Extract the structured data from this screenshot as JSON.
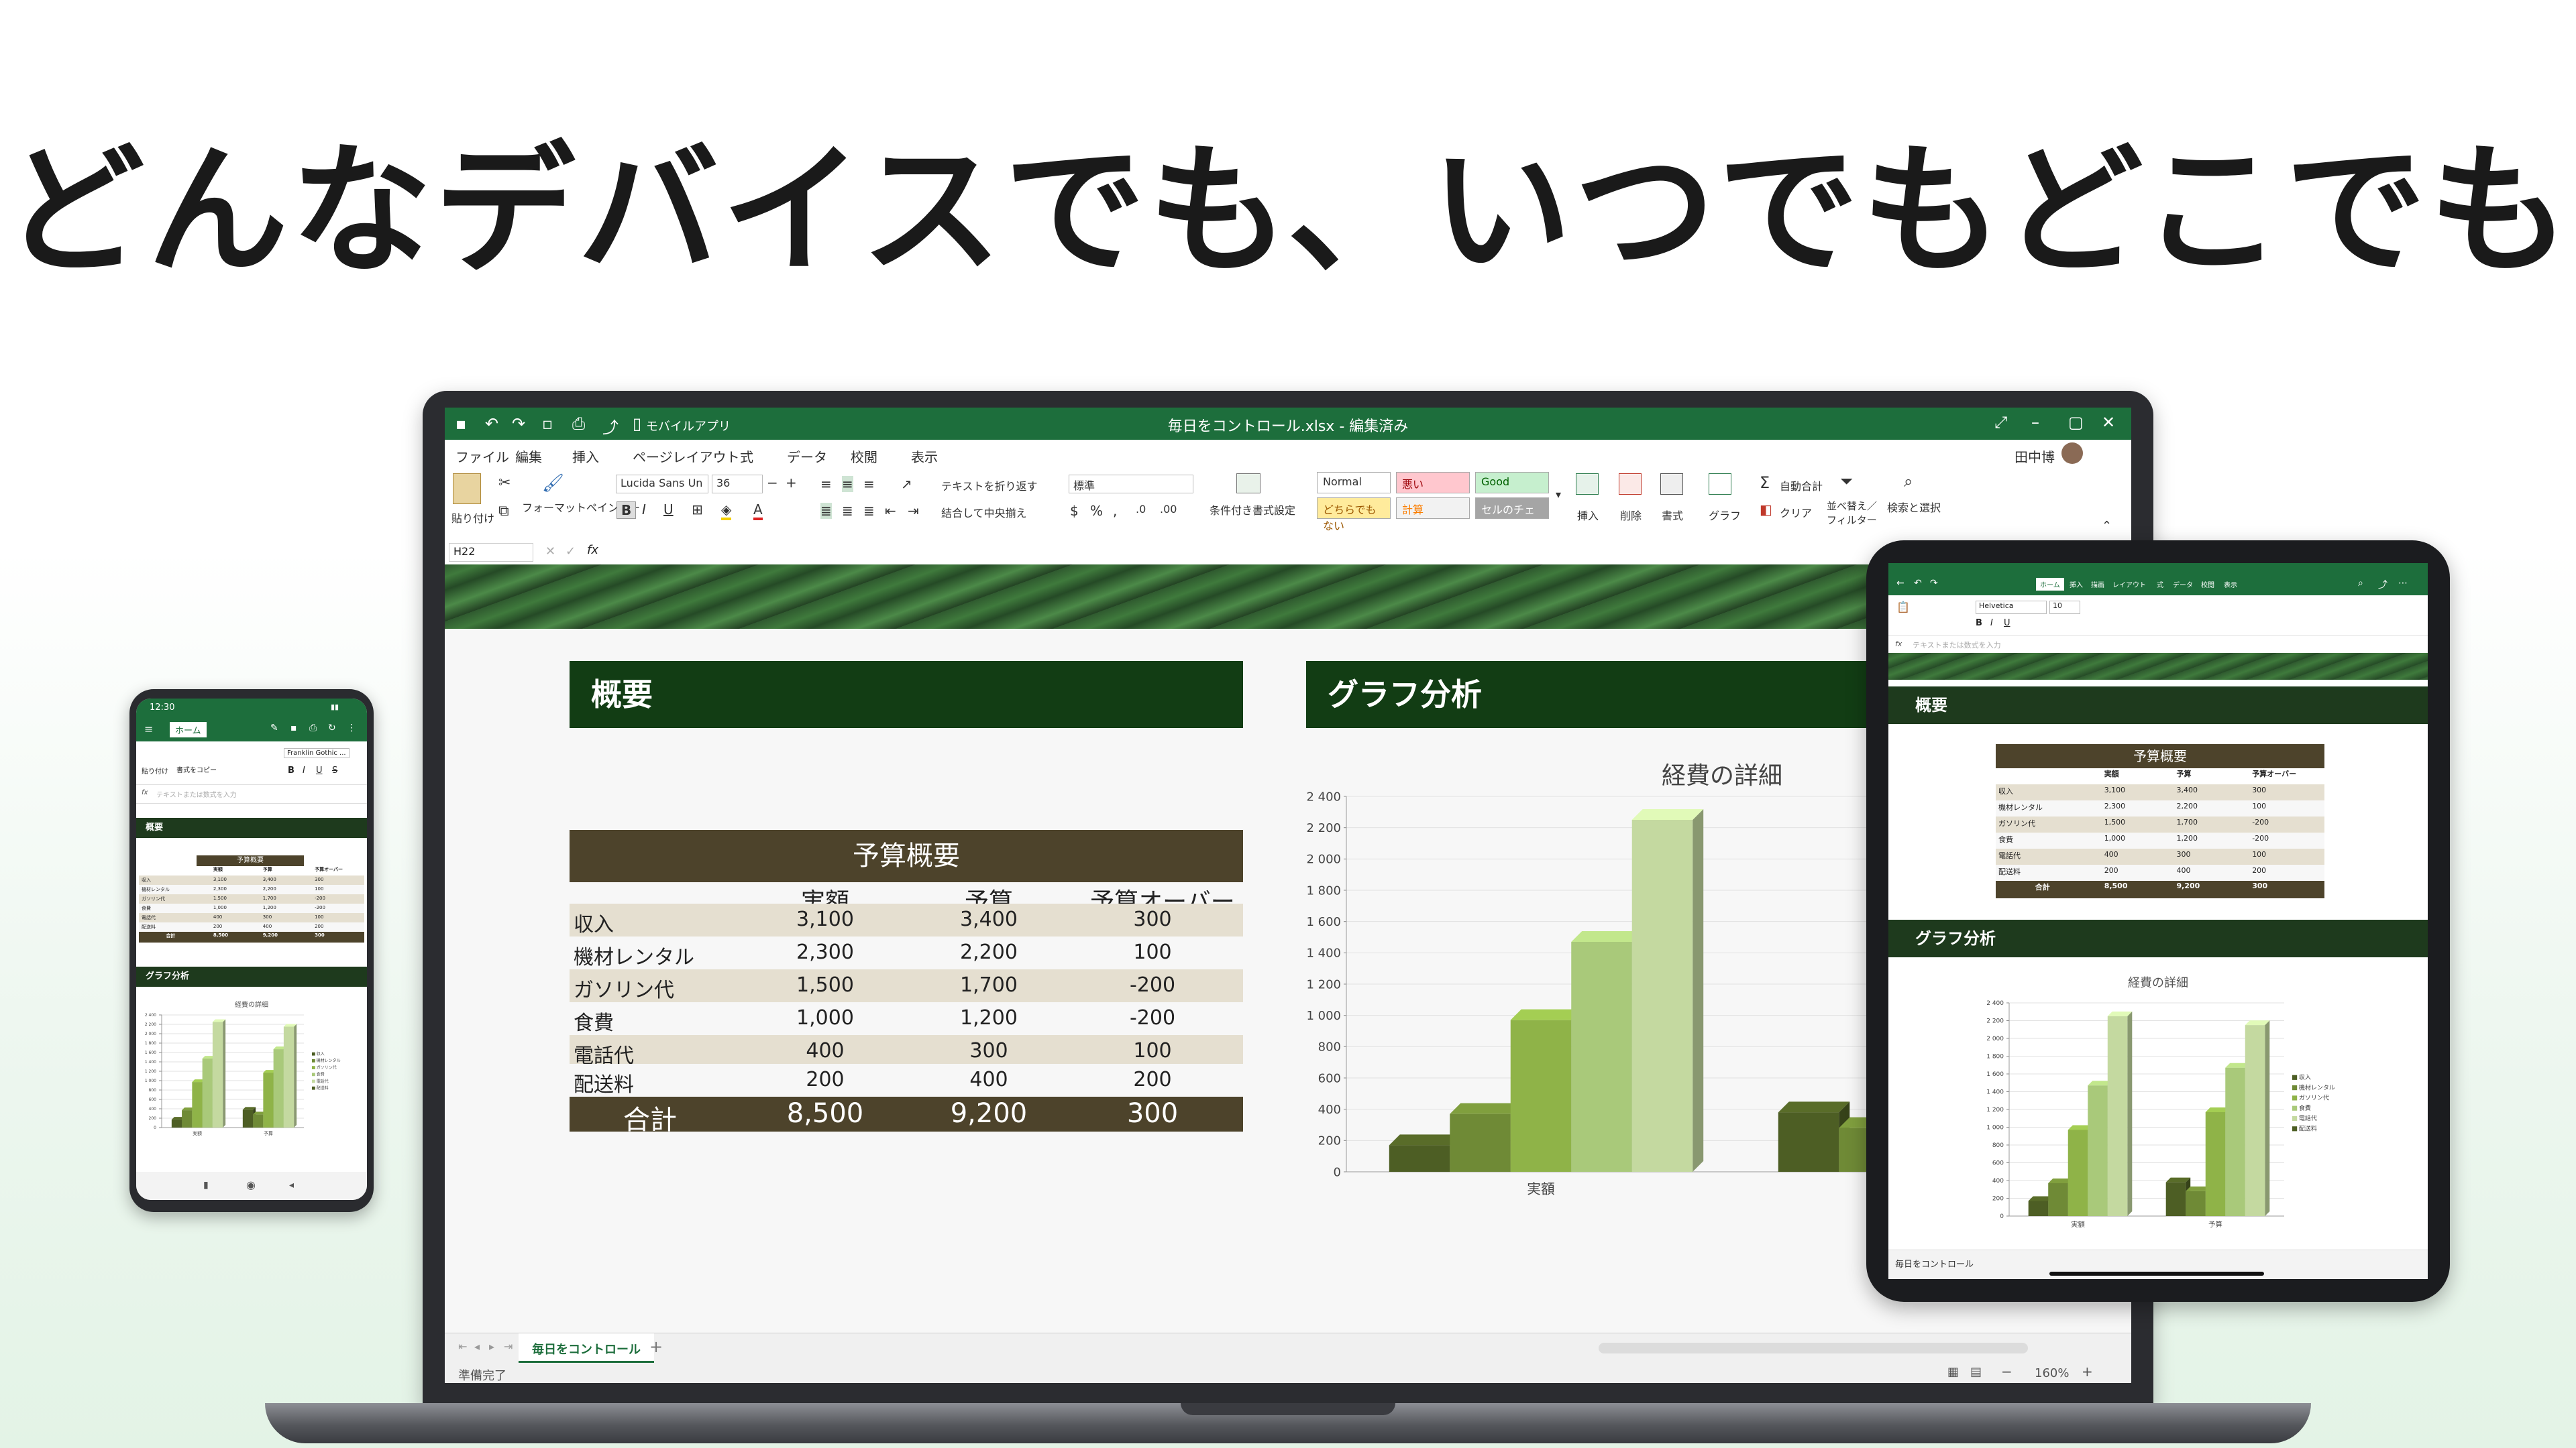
{
  "headline": "どんなデバイスでも、いつでもどこでも",
  "laptop": {
    "window_title": "毎日をコントロール.xlsx - 編集済み",
    "mobile_app_label": "モバイルアプリ",
    "user_name": "田中博",
    "menu": [
      "ファイル",
      "編集",
      "挿入",
      "ページレイアウト",
      "式",
      "データ",
      "校閲",
      "表示"
    ],
    "ribbon": {
      "paste": "貼り付け",
      "format_painter": "フォーマットペインター",
      "font_name": "Lucida Sans Un",
      "font_size": "36",
      "wrap_text": "テキストを折り返す",
      "merge_center": "結合して中央揃え",
      "number_format": "標準",
      "conditional_format": "条件付き書式設定",
      "styles": {
        "normal": "Normal",
        "bad": "悪い",
        "good": "Good",
        "neutral": "どちらでもない",
        "calc": "計算",
        "check": "セルのチェック"
      },
      "insert": "挿入",
      "delete": "削除",
      "format": "書式",
      "chart": "グラフ",
      "autosum": "自動合計",
      "clear": "クリア",
      "sort_filter": "並べ替え／フィルター",
      "find_select": "検索と選択"
    },
    "formula": {
      "cell_ref": "H22",
      "fx": "fx"
    },
    "section_overview": "概要",
    "section_chart": "グラフ分析",
    "sheet_tab": "毎日をコントロール",
    "status_left": "準備完了",
    "zoom": "160%"
  },
  "budget_table": {
    "title": "予算概要",
    "headers": [
      "実額",
      "予算",
      "予算オーバー"
    ],
    "rows": [
      {
        "label": "収入",
        "actual": "3,100",
        "budget": "3,400",
        "over": "300"
      },
      {
        "label": "機材レンタル",
        "actual": "2,300",
        "budget": "2,200",
        "over": "100"
      },
      {
        "label": "ガソリン代",
        "actual": "1,500",
        "budget": "1,700",
        "over": "-200"
      },
      {
        "label": "食費",
        "actual": "1,000",
        "budget": "1,200",
        "over": "-200"
      },
      {
        "label": "電話代",
        "actual": "400",
        "budget": "300",
        "over": "100"
      },
      {
        "label": "配送料",
        "actual": "200",
        "budget": "400",
        "over": "200"
      }
    ],
    "total": {
      "label": "合計",
      "actual": "8,500",
      "budget": "9,200",
      "over": "300"
    }
  },
  "chart_data": {
    "type": "bar",
    "title": "経費の詳細",
    "categories": [
      "実額",
      "予算"
    ],
    "series": [
      {
        "name": "収入",
        "values": [
          170,
          380
        ]
      },
      {
        "name": "機材レンタル",
        "values": [
          370,
          280
        ]
      },
      {
        "name": "ガソリン代",
        "values": [
          970,
          1170
        ]
      },
      {
        "name": "食費",
        "values": [
          1470,
          1670
        ]
      },
      {
        "name": "電話代",
        "values": [
          2250,
          2150
        ]
      }
    ],
    "ylim": [
      0,
      2400
    ],
    "yticks": [
      "0",
      "200",
      "400",
      "600",
      "800",
      "1 000",
      "1 200",
      "1 400",
      "1 600",
      "1 800",
      "2 000",
      "2 200",
      "2 400"
    ],
    "colors": [
      "#4d5e24",
      "#6f8a36",
      "#8fb348",
      "#a9c97a",
      "#c4d9a0"
    ]
  },
  "tablet": {
    "tabs": [
      "ホーム",
      "挿入",
      "描画",
      "レイアウト",
      "式",
      "データ",
      "校閲",
      "表示"
    ],
    "font": "Helvetica",
    "font_size": "10",
    "formula_placeholder": "テキストまたは数式を入力",
    "sheet_tab": "毎日をコントロール",
    "legend": [
      "収入",
      "機材レンタル",
      "ガソリン代",
      "食費",
      "電話代",
      "配送料"
    ]
  },
  "phone": {
    "time": "12:30",
    "tab": "ホーム",
    "font": "Franklin Gothic ...",
    "formula_placeholder": "テキストまたは数式を入力",
    "paste": "貼り付け",
    "copy_format": "書式をコピー"
  }
}
